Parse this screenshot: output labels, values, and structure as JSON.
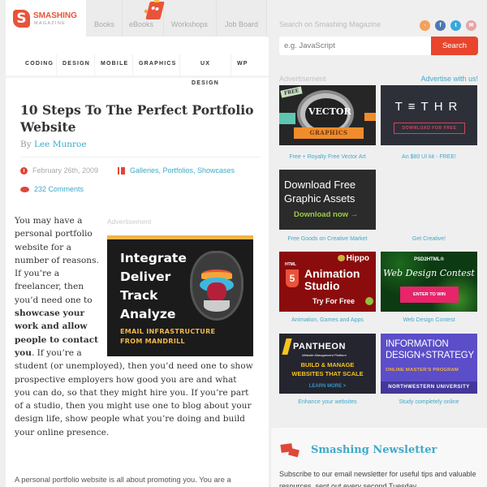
{
  "header": {
    "logo": {
      "mark": "S",
      "title": "SMASHING",
      "subtitle": "MAGAZINE"
    },
    "nav": [
      {
        "label": "Books"
      },
      {
        "label": "eBooks"
      },
      {
        "label": "Workshops"
      },
      {
        "label": "Job Board"
      }
    ]
  },
  "categories": [
    {
      "label": "CODING",
      "color": "#a8dbe3"
    },
    {
      "label": "DESIGN",
      "color": "#9fd888"
    },
    {
      "label": "MOBILE",
      "color": "#f5e88a"
    },
    {
      "label": "GRAPHICS",
      "color": "#d5b8df"
    },
    {
      "label": "UX DESIGN",
      "color": "#f5b7bd"
    },
    {
      "label": "WP",
      "color": "#a8c8ea"
    }
  ],
  "article": {
    "title": "10 Steps To The Perfect Portfolio Website",
    "byline_prefix": "By",
    "author": "Lee Munroe",
    "date": "February 26th, 2009",
    "categories": "Galleries, Portfolios, Showcases",
    "comments": "232 Comments",
    "paragraph1": {
      "part1": "You may have a personal portfolio website for a number of reasons. If you’re a freelancer, then you’d need one to ",
      "bold": "showcase your work and allow people to contact you",
      "part2": ". If you’re a student (or unemployed), then you’d need one to show prospective employers how good you are and what you can do, so that they might hire you. If you’re part of a studio, then you might use one to blog about your design life, show people what you’re doing and build your online presence."
    },
    "paragraph2": "A personal portfolio website is all about promoting you. You are a",
    "inline_ad": {
      "label": "Advertisement",
      "lines": [
        "Integrate",
        "Deliver",
        "Track",
        "Analyze"
      ],
      "tagline_1": "EMAIL INFRASTRUCTURE",
      "tagline_2": "FROM MANDRILL"
    }
  },
  "sidebar": {
    "search_label": "Search on Smashing Magazine",
    "search_placeholder": "e.g. JavaScript",
    "search_button": "Search",
    "social": [
      {
        "icon": "rss-icon",
        "glyph": "◦",
        "color": "#f2a25b"
      },
      {
        "icon": "facebook-icon",
        "glyph": "f",
        "color": "#4d79b3"
      },
      {
        "icon": "twitter-icon",
        "glyph": "t",
        "color": "#39a7dc"
      },
      {
        "icon": "email-icon",
        "glyph": "✉",
        "color": "#e8a3a6"
      }
    ],
    "ad_label": "Advertisement",
    "advertise_link": "Advertise with us!",
    "ads": [
      {
        "caption": "Free + Royalty Free Vector Art",
        "free": "FREE",
        "big": "VECTOR",
        "ribbon": "GRAPHICS"
      },
      {
        "caption": "An $80 UI kit - FREE!",
        "big": "T≡THR",
        "button": "DOWNLOAD FOR FREE"
      },
      {
        "caption": "Free Goods on Creative Market",
        "line1": "Download Free",
        "line2": "Graphic Assets",
        "cta": "Download now →"
      },
      {
        "caption": "Get Creative!"
      },
      {
        "caption": "Animation, Games and Apps",
        "brand": "Hippo",
        "html_tag": "HTML",
        "html_num": "5",
        "line1": "Animation",
        "line2": "Studio",
        "cta": "Try For Free"
      },
      {
        "caption": "Web Design Contest",
        "brand": "PSD2HTML®",
        "headline": "Web Design Contest",
        "button": "ENTER TO WIN"
      },
      {
        "caption": "Enhance your websites",
        "brand": "PANTHEON",
        "sub": "Website Management Platform",
        "line1": "BUILD & MANAGE",
        "line2": "WEBSITES THAT SCALE",
        "cta": "LEARN MORE >"
      },
      {
        "caption": "Study completely online",
        "line1": "INFORMATION",
        "line2": "DESIGN+STRATEGY",
        "line3": "ONLINE MASTER’S PROGRAM",
        "footer": "NORTHWESTERN UNIVERSITY"
      }
    ],
    "newsletter": {
      "title": "Smashing Newsletter",
      "text": "Subscribe to our email newsletter for useful tips and valuable resources, sent out every second Tuesday."
    }
  }
}
